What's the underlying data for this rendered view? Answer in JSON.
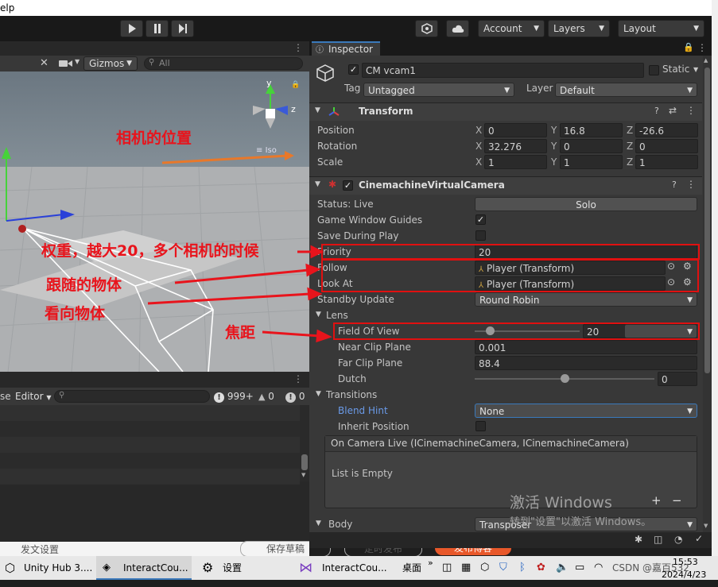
{
  "menubar": {
    "help_fragment": "elp"
  },
  "toolbar": {
    "account_label": "Account",
    "layers_label": "Layers",
    "layout_label": "Layout",
    "play_icon": "play-icon",
    "pause_icon": "pause-icon",
    "step_icon": "step-icon"
  },
  "scene": {
    "gizmos_label": "Gizmos",
    "search_placeholder": "All",
    "axis_y": "y",
    "axis_z": "z",
    "projection_label": "Iso"
  },
  "console": {
    "editor_label": "Editor",
    "prefix_fragment": "se",
    "count_info": "999+",
    "count_warn": "0",
    "count_error": "0"
  },
  "inspector": {
    "tab_label": "Inspector",
    "object_name": "CM vcam1",
    "static_label": "Static",
    "tag_label": "Tag",
    "tag_value": "Untagged",
    "layer_label": "Layer",
    "layer_value": "Default",
    "transform": {
      "header": "Transform",
      "position_label": "Position",
      "rotation_label": "Rotation",
      "scale_label": "Scale",
      "position": {
        "x": "0",
        "y": "16.8",
        "z": "-26.6"
      },
      "rotation": {
        "x": "32.276",
        "y": "0",
        "z": "0"
      },
      "scale": {
        "x": "1",
        "y": "1",
        "z": "1"
      }
    },
    "vcam": {
      "header": "CinemachineVirtualCamera",
      "status_label": "Status: Live",
      "solo_button": "Solo",
      "guides_label": "Game Window Guides",
      "save_label": "Save During Play",
      "priority_label": "Priority",
      "priority_value": "20",
      "follow_label": "Follow",
      "follow_value": "Player (Transform)",
      "lookat_label": "Look At",
      "lookat_value": "Player (Transform)",
      "standby_label": "Standby Update",
      "standby_value": "Round Robin",
      "lens_label": "Lens",
      "fov_label": "Field Of View",
      "fov_value": "20",
      "near_label": "Near Clip Plane",
      "near_value": "0.001",
      "far_label": "Far Clip Plane",
      "far_value": "88.4",
      "dutch_label": "Dutch",
      "dutch_value": "0",
      "transitions_label": "Transitions",
      "blend_label": "Blend Hint",
      "blend_value": "None",
      "inherit_label": "Inherit Position",
      "event_label": "On Camera Live (ICinemachineCamera, ICinemachineCamera)",
      "event_empty": "List is Empty",
      "body_label": "Body",
      "body_value": "Transposer"
    }
  },
  "annotations": {
    "camera_position": "相机的位置",
    "priority_note": "权重，越大20，多个相机的时候",
    "follow_note": "跟随的物体",
    "lookat_note": "看向物体",
    "fov_note": "焦距"
  },
  "watermark": {
    "line1": "激活 Windows",
    "line2": "转到\"设置\"以激活 Windows。"
  },
  "taskbar": {
    "unity_hub": "Unity Hub 3....",
    "interact_unity": "InteractCou...",
    "settings": "设置",
    "interact_vs": "InteractCou...",
    "desktop": "桌面",
    "time": "15:53",
    "date": "2024/4/23",
    "csdn": "CSDN @嘉百532",
    "behind_text_1": "发文设置",
    "behind_text_2": "保存草稿",
    "behind_text_3": "定时发布",
    "behind_text_4": "发布博客"
  },
  "colors": {
    "accent_blue": "#3a79bb",
    "annotation_red": "#e8141c",
    "arrow_orange": "#e8782a"
  }
}
